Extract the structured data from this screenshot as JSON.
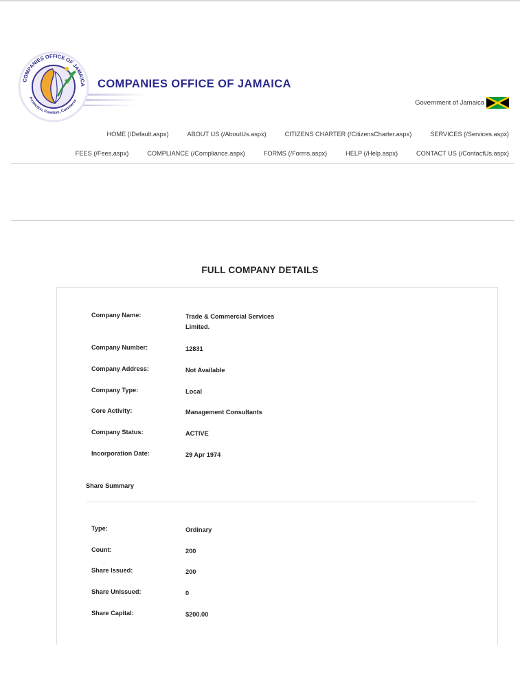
{
  "header": {
    "logo_ring_text_top": "COMPANIES OFFICE OF JAMAICA",
    "logo_ring_text_bottom": "Protection, Freedom, Commerce",
    "title": "COMPANIES OFFICE OF JAMAICA",
    "gov_text": "Government of Jamaica",
    "flag_icon": "jamaica-flag-icon"
  },
  "nav": {
    "row1": [
      "HOME (/Default.aspx)",
      "ABOUT US (/AboutUs.aspx)",
      "CITIZENS CHARTER (/CitizensCharter.aspx)",
      "SERVICES (/Services.aspx)"
    ],
    "row2": [
      "FEES (/Fees.aspx)",
      "COMPLIANCE (/Compliance.aspx)",
      "FORMS (/Forms.aspx)",
      "HELP (/Help.aspx)",
      "CONTACT US (/ContactUs.aspx)"
    ]
  },
  "main": {
    "heading": "FULL COMPANY DETAILS",
    "details": [
      {
        "label": "Company Name:",
        "value": "Trade & Commercial Services Limited."
      },
      {
        "label": "Company Number:",
        "value": "12831"
      },
      {
        "label": "Company Address:",
        "value": "Not Available"
      },
      {
        "label": "Company Type:",
        "value": "Local"
      },
      {
        "label": "Core Activity:",
        "value": "Management Consultants"
      },
      {
        "label": "Company Status:",
        "value": "ACTIVE"
      },
      {
        "label": "Incorporation Date:",
        "value": "29 Apr 1974"
      }
    ],
    "share_summary_title": "Share Summary",
    "share": [
      {
        "label": "Type:",
        "value": "Ordinary"
      },
      {
        "label": "Count:",
        "value": "200"
      },
      {
        "label": "Share Issued:",
        "value": "200"
      },
      {
        "label": "Share UnIssued:",
        "value": "0"
      },
      {
        "label": "Share Capital:",
        "value": "$200.00"
      }
    ]
  },
  "colors": {
    "brand": "#2b2a8e",
    "flag_green": "#009b3a",
    "flag_gold": "#fed100",
    "flag_black": "#000000"
  }
}
